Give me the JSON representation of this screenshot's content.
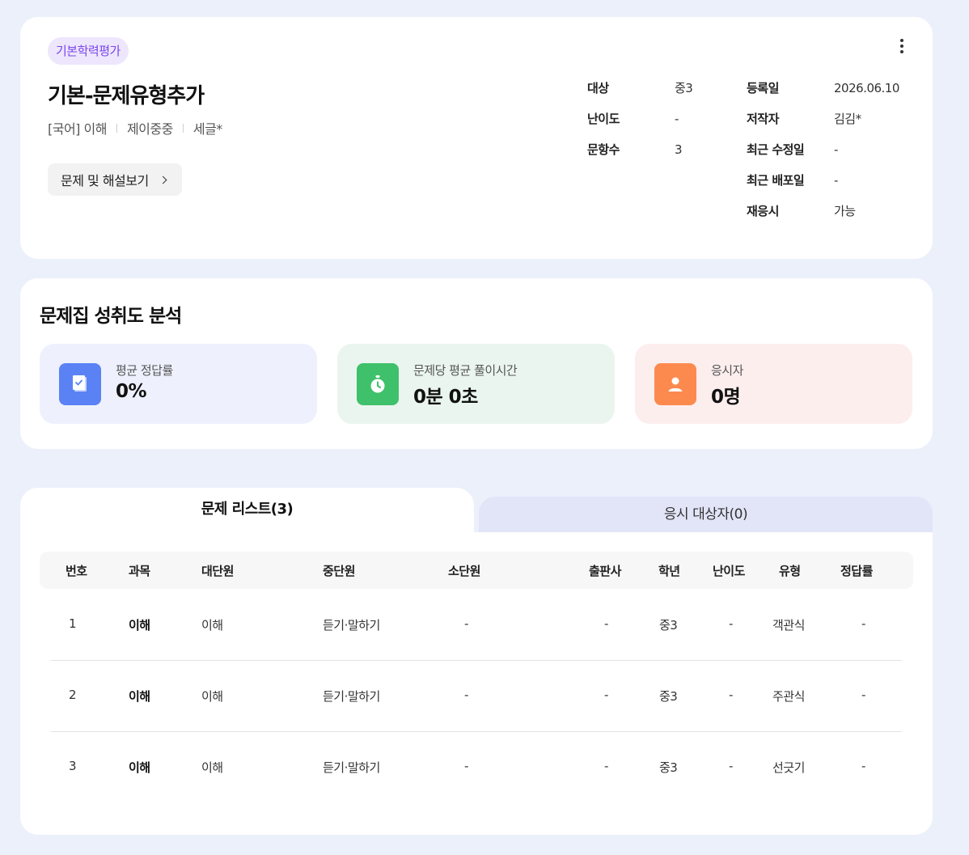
{
  "info": {
    "category_chip": "기본학력평가",
    "title": "기본-문제유형추가",
    "meta": [
      "[국어] 이해",
      "제이중중",
      "세글*"
    ],
    "view_button": "문제 및 해설보기",
    "details_left": [
      {
        "label": "대상",
        "value": "중3"
      },
      {
        "label": "난이도",
        "value": "-"
      },
      {
        "label": "문항수",
        "value": "3"
      }
    ],
    "details_right": [
      {
        "label": "등록일",
        "value": "2026.06.10"
      },
      {
        "label": "저작자",
        "value": "김김*"
      },
      {
        "label": "최근 수정일",
        "value": "-"
      },
      {
        "label": "최근 배포일",
        "value": "-"
      },
      {
        "label": "재응시",
        "value": "가능"
      }
    ]
  },
  "stats": {
    "section_title": "문제집 성취도 분석",
    "items": [
      {
        "label": "평균 정답률",
        "value": "0%",
        "icon": "book-check-icon",
        "color": "#5b82f5",
        "bg": "#eef1fd"
      },
      {
        "label": "문제당 평균 풀이시간",
        "value": "0분 0초",
        "icon": "stopwatch-icon",
        "color": "#3fc06a",
        "bg": "#eaf5ef"
      },
      {
        "label": "응시자",
        "value": "0명",
        "icon": "user-icon",
        "color": "#fc8a4e",
        "bg": "#fdeeee"
      }
    ]
  },
  "tabs": {
    "problems": "문제 리스트(3)",
    "examinees": "응시 대상자(0)"
  },
  "table": {
    "columns": [
      "번호",
      "과목",
      "대단원",
      "중단원",
      "소단원",
      "출판사",
      "학년",
      "난이도",
      "유형",
      "정답률"
    ],
    "rows": [
      [
        "1",
        "이해",
        "이해",
        "듣기·말하기",
        "-",
        "-",
        "중3",
        "-",
        "객관식",
        "-"
      ],
      [
        "2",
        "이해",
        "이해",
        "듣기·말하기",
        "-",
        "-",
        "중3",
        "-",
        "주관식",
        "-"
      ],
      [
        "3",
        "이해",
        "이해",
        "듣기·말하기",
        "-",
        "-",
        "중3",
        "-",
        "선긋기",
        "-"
      ]
    ]
  }
}
